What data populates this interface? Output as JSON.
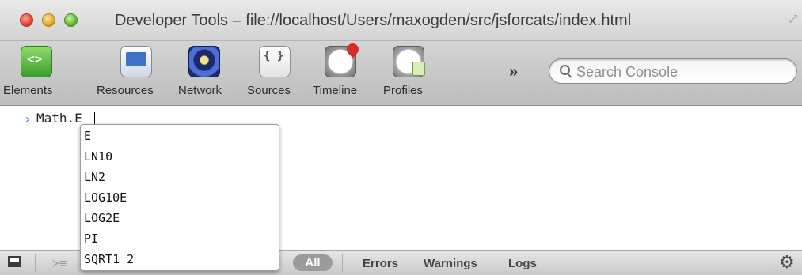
{
  "window": {
    "title": "Developer Tools – file://localhost/Users/maxogden/src/jsforcats/index.html",
    "resize_glyph": "⤢"
  },
  "toolbar": {
    "tools": [
      {
        "label": "Elements",
        "icon": "elements-icon"
      },
      {
        "label": "Resources",
        "icon": "resources-icon"
      },
      {
        "label": "Network",
        "icon": "network-icon"
      },
      {
        "label": "Sources",
        "icon": "sources-icon"
      },
      {
        "label": "Timeline",
        "icon": "timeline-icon"
      },
      {
        "label": "Profiles",
        "icon": "profiles-icon"
      }
    ],
    "overflow_label": "»",
    "search": {
      "placeholder": "Search Console",
      "value": ""
    }
  },
  "console": {
    "prompt": "›",
    "input": "Math.E",
    "autocomplete": [
      "E",
      "LN10",
      "LN2",
      "LOG10E",
      "LOG2E",
      "PI",
      "SQRT1_2"
    ]
  },
  "statusbar": {
    "filters": {
      "all": "All",
      "errors": "Errors",
      "warnings": "Warnings",
      "logs": "Logs"
    },
    "drawer_glyph": "≻≡",
    "gear_glyph": "⚙"
  }
}
